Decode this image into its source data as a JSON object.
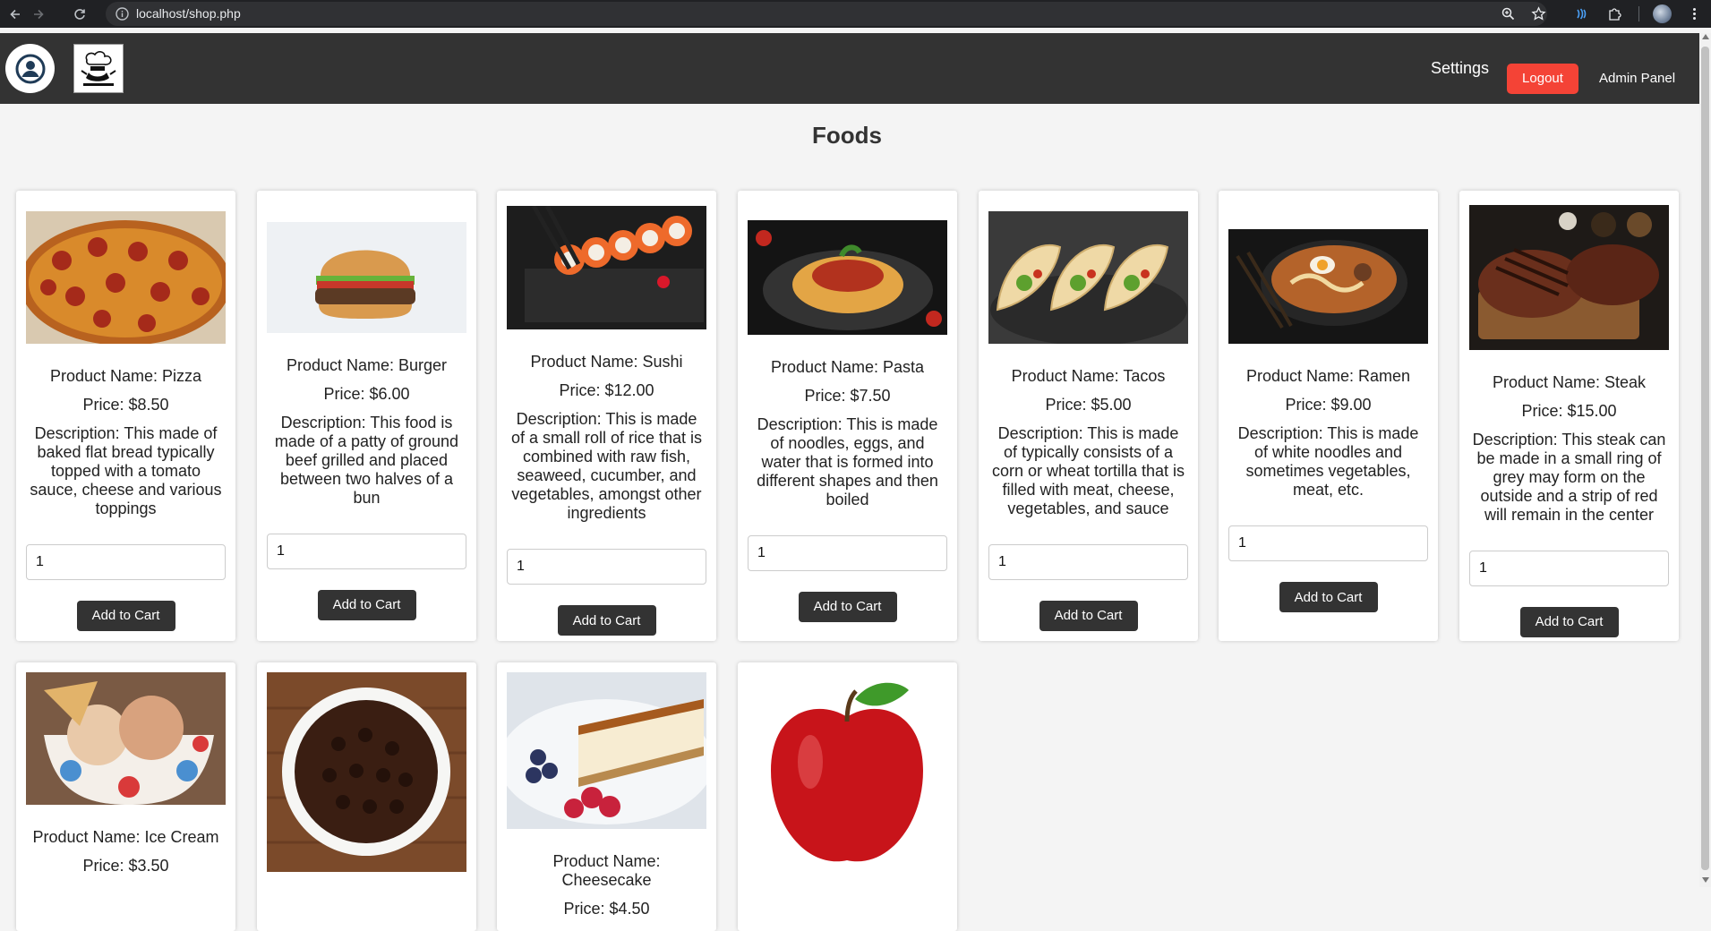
{
  "browser": {
    "url": "localhost/shop.php"
  },
  "header": {
    "settings_label": "Settings",
    "logout_label": "Logout",
    "admin_label": "Admin Panel"
  },
  "page": {
    "title": "Foods"
  },
  "products": [
    {
      "name": "Product Name: Pizza",
      "price": "Price: $8.50",
      "description": "Description: This made of baked flat bread typically topped with a tomato sauce, cheese and various toppings",
      "qty": "1",
      "button": "Add to Cart"
    },
    {
      "name": "Product Name: Burger",
      "price": "Price: $6.00",
      "description": "Description: This food is made of a patty of ground beef grilled and placed between two halves of a bun",
      "qty": "1",
      "button": "Add to Cart"
    },
    {
      "name": "Product Name: Sushi",
      "price": "Price: $12.00",
      "description": "Description: This is made of a small roll of rice that is combined with raw fish, seaweed, cucumber, and vegetables, amongst other ingredients",
      "qty": "1",
      "button": "Add to Cart"
    },
    {
      "name": "Product Name: Pasta",
      "price": "Price: $7.50",
      "description": "Description: This is made of noodles, eggs, and water that is formed into different shapes and then boiled",
      "qty": "1",
      "button": "Add to Cart"
    },
    {
      "name": "Product Name: Tacos",
      "price": "Price: $5.00",
      "description": "Description: This is made of typically consists of a corn or wheat tortilla that is filled with meat, cheese, vegetables, and sauce",
      "qty": "1",
      "button": "Add to Cart"
    },
    {
      "name": "Product Name: Ramen",
      "price": "Price: $9.00",
      "description": "Description: This is made of white noodles and sometimes vegetables, meat, etc.",
      "qty": "1",
      "button": "Add to Cart"
    },
    {
      "name": "Product Name: Steak",
      "price": "Price: $15.00",
      "description": "Description: This steak can be made in a small ring of grey may form on the outside and a strip of red will remain in the center",
      "qty": "1",
      "button": "Add to Cart"
    },
    {
      "name": "Product Name: Ice Cream",
      "price": "Price: $3.50"
    },
    {
      "name": "",
      "price": ""
    },
    {
      "name": "Product Name: Cheesecake",
      "price": "Price: $4.50"
    },
    {
      "name": "",
      "price": ""
    }
  ]
}
